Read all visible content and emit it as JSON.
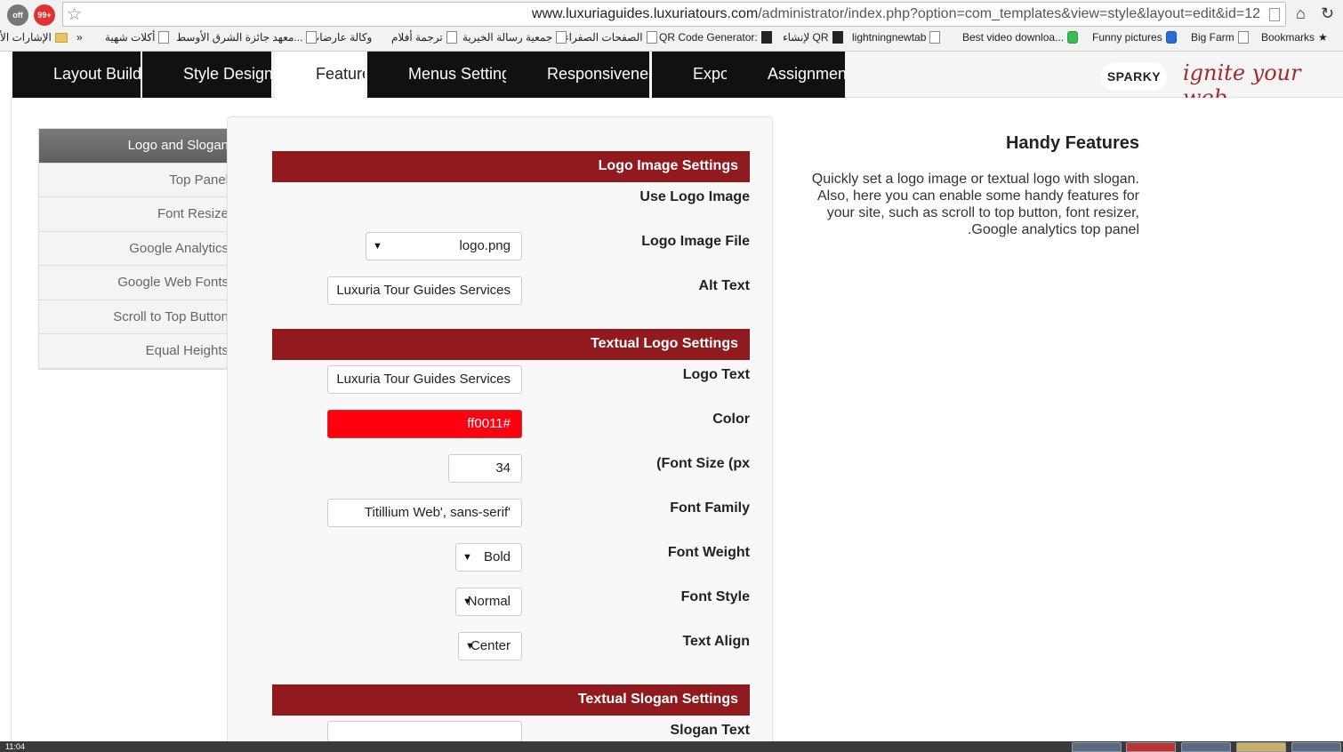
{
  "browser": {
    "url_host": "www.luxuriaguides.luxuriatours.com",
    "url_path": "/administrator/index.php?option=com_templates&view=style&layout=edit&id=12",
    "bookmarks": [
      "Bookmarks",
      "Big Farm",
      "Funny pictures",
      "Best video downloa...",
      "lightningnewtab",
      "لإنشاء QR",
      "QR Code Generator:",
      "الصفحات الصفراء",
      "جمعية رسالة الخيرية",
      "ترجمة أفلام",
      "وكالة عارضات",
      "معهد جائزة الشرق الأوسط...",
      "أكلات شهية",
      "»",
      "الإشارات الأ"
    ],
    "ext_badge": "99+",
    "ext_badge2": "off"
  },
  "tabs": [
    {
      "label": "Layout Builder"
    },
    {
      "label": "Style Designer"
    },
    {
      "label": "Features"
    },
    {
      "label": "Menus Settings"
    },
    {
      "label": "Responsiveness"
    },
    {
      "label": "Export"
    },
    {
      "label": "Assignments"
    }
  ],
  "brand": {
    "logo": "SPARKY",
    "tagline": "ignite your web"
  },
  "sidebar": {
    "items": [
      {
        "label": "Logo and Slogan"
      },
      {
        "label": "Top Panel"
      },
      {
        "label": "Font Resize"
      },
      {
        "label": "Google Analytics"
      },
      {
        "label": "Google Web Fonts"
      },
      {
        "label": "Scroll to Top Button"
      },
      {
        "label": "Equal Heights"
      }
    ]
  },
  "sections": {
    "logo_image": "Logo Image Settings",
    "textual_logo": "Textual Logo Settings",
    "textual_slogan": "Textual Slogan Settings"
  },
  "fields": {
    "use_logo_image": {
      "label": "Use Logo Image"
    },
    "logo_image_file": {
      "label": "Logo Image File",
      "value": "logo.png"
    },
    "alt_text": {
      "label": "Alt Text",
      "value": "Luxuria Tour Guides Services"
    },
    "logo_text": {
      "label": "Logo Text",
      "value": "Luxuria Tour Guides Services"
    },
    "color": {
      "label": "Color",
      "value": "ff0011#"
    },
    "font_size": {
      "label": "(Font Size (px",
      "value": "34"
    },
    "font_family": {
      "label": "Font Family",
      "value": "Titillium Web', sans-serif'"
    },
    "font_weight": {
      "label": "Font Weight",
      "value": "Bold"
    },
    "font_style": {
      "label": "Font Style",
      "value": "Normal"
    },
    "text_align": {
      "label": "Text Align",
      "value": "Center"
    },
    "slogan_text": {
      "label": "Slogan Text",
      "value": ""
    }
  },
  "help": {
    "title": "Handy Features",
    "text": "Quickly set a logo image or textual logo with slogan. Also, here you can enable some handy features for your site, such as scroll to top button, font resizer, Google analytics top panel."
  },
  "taskbar": {
    "time": "11:04"
  },
  "colors": {
    "accent": "#911a1e",
    "color_swatch": "#ff0011",
    "tab_bg": "#111111"
  }
}
